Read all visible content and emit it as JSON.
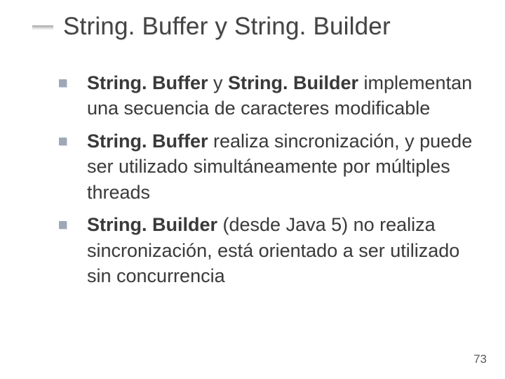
{
  "slide": {
    "title": "String. Buffer y String. Builder",
    "bullets": [
      {
        "kw1": "String. Buffer",
        "conn": " y ",
        "kw2": "String. Builder",
        "rest": " implementan una secuencia de caracteres modificable"
      },
      {
        "kw1": "String. Buffer",
        "rest": " realiza sincronización, y puede ser utilizado simultáneamente por múltiples threads"
      },
      {
        "kw1": "String. Builder",
        "rest": " (desde Java 5) no realiza sincronización, está orientado a ser utilizado sin concurrencia"
      }
    ],
    "page_number": "73"
  }
}
